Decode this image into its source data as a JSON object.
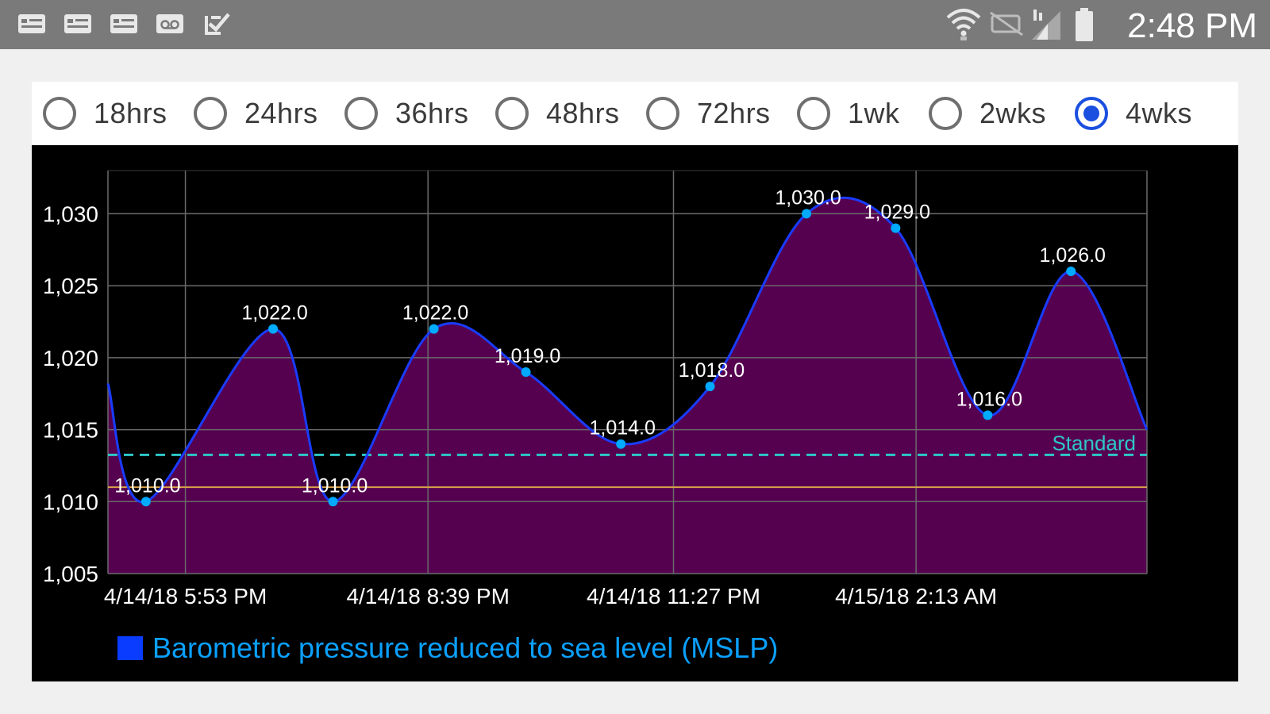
{
  "status_bar": {
    "time": "2:48 PM",
    "left_icons": [
      "notification-card-icon",
      "notification-card-icon",
      "notification-card-icon",
      "voicemail-icon",
      "task-check-icon"
    ],
    "right_icons": [
      "wifi-icon",
      "nfc-off-icon",
      "cell-signal-icon",
      "battery-icon"
    ]
  },
  "range_selector": {
    "options": [
      {
        "label": "18hrs",
        "checked": false
      },
      {
        "label": "24hrs",
        "checked": false
      },
      {
        "label": "36hrs",
        "checked": false
      },
      {
        "label": "48hrs",
        "checked": false
      },
      {
        "label": "72hrs",
        "checked": false
      },
      {
        "label": "1wk",
        "checked": false
      },
      {
        "label": "2wks",
        "checked": false
      },
      {
        "label": "4wks",
        "checked": true
      }
    ]
  },
  "chart_data": {
    "type": "area",
    "title": "",
    "xlabel": "",
    "ylabel": "",
    "ylim": [
      1005,
      1033
    ],
    "yticks": [
      1005,
      1010,
      1015,
      1020,
      1025,
      1030
    ],
    "ytick_labels": [
      "1,005",
      "1,010",
      "1,015",
      "1,020",
      "1,025",
      "1,030"
    ],
    "xtick_labels": [
      "4/14/18 5:53 PM",
      "4/14/18 8:39 PM",
      "4/14/18 11:27 PM",
      "4/15/18 2:13 AM"
    ],
    "grid": true,
    "series": [
      {
        "name": "Barometric pressure reduced to sea level (MSLP)",
        "color": "#1a3cff",
        "fill": "#560050",
        "points": [
          {
            "x": "4/14/18 5:00 PM",
            "y": 1018.2,
            "label": ""
          },
          {
            "x": "4/14/18 5:26 PM",
            "y": 1010.0,
            "label": "1,010.0"
          },
          {
            "x": "4/14/18 6:53 PM",
            "y": 1022.0,
            "label": "1,022.0"
          },
          {
            "x": "4/14/18 7:34 PM",
            "y": 1010.0,
            "label": "1,010.0"
          },
          {
            "x": "4/14/18 8:43 PM",
            "y": 1022.0,
            "label": "1,022.0"
          },
          {
            "x": "4/14/18 9:46 PM",
            "y": 1019.0,
            "label": "1,019.0"
          },
          {
            "x": "4/14/18 10:51 PM",
            "y": 1014.0,
            "label": "1,014.0"
          },
          {
            "x": "4/14/18 11:52 PM",
            "y": 1018.0,
            "label": "1,018.0"
          },
          {
            "x": "4/15/18 12:58 AM",
            "y": 1030.0,
            "label": "1,030.0"
          },
          {
            "x": "4/15/18 1:59 AM",
            "y": 1029.0,
            "label": "1,029.0"
          },
          {
            "x": "4/15/18 3:02 AM",
            "y": 1016.0,
            "label": "1,016.0"
          },
          {
            "x": "4/15/18 3:59 AM",
            "y": 1026.0,
            "label": "1,026.0"
          },
          {
            "x": "4/15/18 4:51 AM",
            "y": 1015.0,
            "label": ""
          }
        ]
      }
    ],
    "reference_lines": [
      {
        "label": "Standard",
        "y": 1013.25,
        "color": "#2ec7c7",
        "style": "dashed"
      },
      {
        "label": "",
        "y": 1011.0,
        "color": "#d9a24a",
        "style": "solid"
      }
    ],
    "legend": {
      "label": "Barometric pressure reduced to sea level (MSLP)",
      "swatch_color": "#0a3cff",
      "text_color": "#0aa0ff",
      "placement": "bottom-left"
    },
    "colors": {
      "line": "#1a3cff",
      "fill": "#560050",
      "point": "#00aaff",
      "grid": "#6a6a6a",
      "axis_text": "#ffffff"
    }
  }
}
